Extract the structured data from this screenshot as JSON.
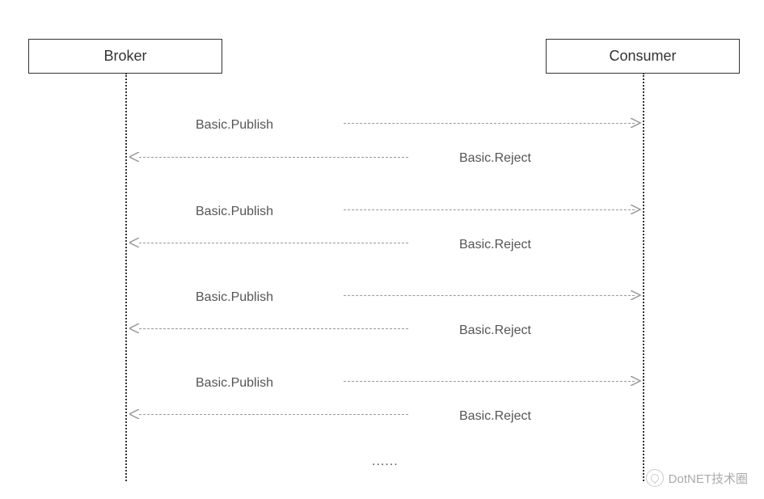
{
  "participants": {
    "left": "Broker",
    "right": "Consumer"
  },
  "messages": {
    "publish": "Basic.Publish",
    "reject": "Basic.Reject"
  },
  "continuation": "......",
  "watermark": "DotNET技术圈",
  "layout": {
    "leftX": 155,
    "rightX": 795,
    "boxTop": 48,
    "boxWidth": 240,
    "boxHeight": 42,
    "lifelineTop": 90,
    "lifelineBottom": 595,
    "arrowSegStart": 425,
    "arrowSegWidthR": 365,
    "arrowSegLeftStart": 165,
    "arrowSegWidthL": 340,
    "pairs": [
      {
        "pubY": 146,
        "pubArrowY": 152,
        "rejY": 187,
        "rejArrowY": 194
      },
      {
        "pubY": 253,
        "pubArrowY": 259,
        "rejY": 294,
        "rejArrowY": 300
      },
      {
        "pubY": 359,
        "pubArrowY": 365,
        "rejY": 400,
        "rejArrowY": 406
      },
      {
        "pubY": 465,
        "pubArrowY": 471,
        "rejY": 506,
        "rejArrowY": 512
      }
    ],
    "contY": 562
  }
}
